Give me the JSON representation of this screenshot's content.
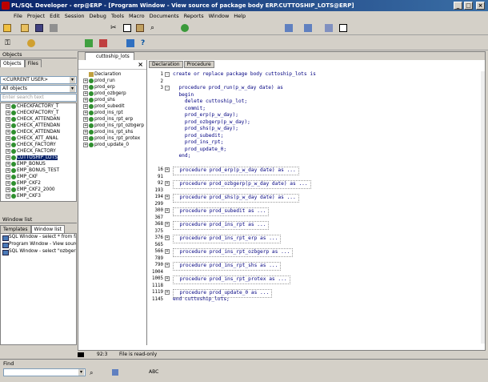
{
  "titlebar": {
    "title": "PL/SQL Developer - erp@ERP - [Program Window - View source of package body ERP.CUTTOSHIP_LOTS@ERP]"
  },
  "menu": [
    "File",
    "Project",
    "Edit",
    "Session",
    "Debug",
    "Tools",
    "Macro",
    "Documents",
    "Reports",
    "Window",
    "Help"
  ],
  "objects": {
    "header": "Objects",
    "tabs": [
      "Objects",
      "Files"
    ],
    "user_combo": "<CURRENT USER>",
    "filter_combo": "All objects",
    "search_placeholder": "Enter search text",
    "items": [
      "CHECKFACTORY_T",
      "CHECKFACTORY_T",
      "CHECK_ATTENDAN",
      "CHECK_ATTENDAN",
      "CHECK_ATTENDAN",
      "CHECK_ATT_ANAL",
      "CHECK_FACTORY",
      "CHECK_FACTORY",
      "CUTTOSHIP_LOTS",
      "EMP_BONUS",
      "EMP_BONUS_TEST",
      "EMP_CKF",
      "EMP_CKF2",
      "EMP_CKF2_2000",
      "EMP_CKF3"
    ]
  },
  "windowlist": {
    "header": "Window list",
    "tabs": [
      "Templates",
      "Window list"
    ],
    "items": [
      "SQL Window - select * from facd0",
      "Program Window - View source of",
      "SQL Window - select \"ozbgerp\" as c"
    ]
  },
  "editor": {
    "tab": "cuttoship_lots",
    "subtabs": [
      "Declaration",
      "Procedure"
    ],
    "nav": [
      "Declaration",
      "prod_run",
      "prod_erp",
      "prod_ozbgerp",
      "prod_shs",
      "prod_subedit",
      "prod_ins_rpt",
      "prod_ins_rpt_erp",
      "prod_ins_rpt_ozbgerp",
      "prod_ins_rpt_shs",
      "prod_ins_rpt_protex",
      "prod_update_0"
    ],
    "lines": [
      {
        "n": "1",
        "t": "create or replace package body cuttoship_lots is",
        "box": "-",
        "c": false
      },
      {
        "n": "2",
        "t": "",
        "box": "",
        "c": false
      },
      {
        "n": "3",
        "t": "  procedure prod_run(p_w_day date) as",
        "box": "-",
        "c": false
      },
      {
        "n": "",
        "t": "  begin",
        "box": "",
        "c": false
      },
      {
        "n": "",
        "t": "    delete cuttoship_lot;",
        "box": "",
        "c": false
      },
      {
        "n": "",
        "t": "    commit;",
        "box": "",
        "c": false
      },
      {
        "n": "",
        "t": "    prod_erp(p_w_day);",
        "box": "",
        "c": false
      },
      {
        "n": "",
        "t": "    prod_ozbgerp(p_w_day);",
        "box": "",
        "c": false
      },
      {
        "n": "",
        "t": "    prod_shs(p_w_day);",
        "box": "",
        "c": false
      },
      {
        "n": "",
        "t": "    prod_subedit;",
        "box": "",
        "c": false
      },
      {
        "n": "",
        "t": "    prod_ins_rpt;",
        "box": "",
        "c": false
      },
      {
        "n": "",
        "t": "    prod_update_0;",
        "box": "",
        "c": false
      },
      {
        "n": "",
        "t": "  end;",
        "box": "",
        "c": false
      },
      {
        "n": "",
        "t": "",
        "box": "",
        "c": false
      },
      {
        "n": "16",
        "t": "  procedure prod_erp(p_w_day date) as ...",
        "box": "+",
        "c": true
      },
      {
        "n": "91",
        "t": "",
        "box": "",
        "c": false
      },
      {
        "n": "92",
        "t": "  procedure prod_ozbgerp(p_w_day date) as ...",
        "box": "+",
        "c": true
      },
      {
        "n": "193",
        "t": "",
        "box": "",
        "c": false
      },
      {
        "n": "194",
        "t": "  procedure prod_shs(p_w_day date) as ...",
        "box": "+",
        "c": true
      },
      {
        "n": "299",
        "t": "",
        "box": "",
        "c": false
      },
      {
        "n": "300",
        "t": "  procedure prod_subedit as ...",
        "box": "+",
        "c": true
      },
      {
        "n": "367",
        "t": "",
        "box": "",
        "c": false
      },
      {
        "n": "368",
        "t": "  procedure prod_ins_rpt as ...",
        "box": "+",
        "c": true
      },
      {
        "n": "375",
        "t": "",
        "box": "",
        "c": false
      },
      {
        "n": "376",
        "t": "  procedure prod_ins_rpt_erp as ...",
        "box": "+",
        "c": true
      },
      {
        "n": "565",
        "t": "",
        "box": "",
        "c": false
      },
      {
        "n": "566",
        "t": "  procedure prod_ins_rpt_ozbgerp as ...",
        "box": "+",
        "c": true
      },
      {
        "n": "789",
        "t": "",
        "box": "",
        "c": false
      },
      {
        "n": "790",
        "t": "  procedure prod_ins_rpt_shs as ...",
        "box": "+",
        "c": true
      },
      {
        "n": "1004",
        "t": "",
        "box": "",
        "c": false
      },
      {
        "n": "1005",
        "t": "  procedure prod_ins_rpt_protex as ...",
        "box": "+",
        "c": true
      },
      {
        "n": "1118",
        "t": "",
        "box": "",
        "c": false
      },
      {
        "n": "1119",
        "t": "  procedure prod_update_0 as ...",
        "box": "+",
        "c": true
      },
      {
        "n": "1145",
        "t": "end cuttoship_lots;",
        "box": "",
        "c": false
      }
    ]
  },
  "status": {
    "position": "92:3",
    "message": "File is read-only"
  },
  "find": {
    "label": "Find"
  }
}
